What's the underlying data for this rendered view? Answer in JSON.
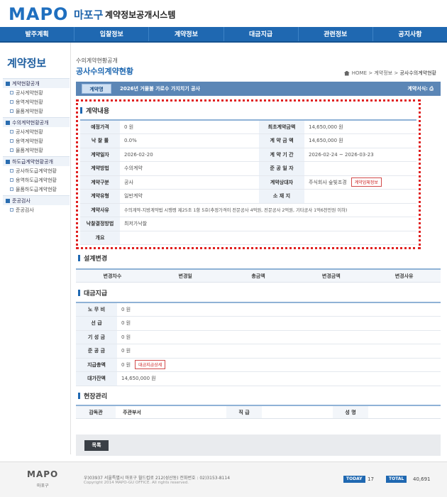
{
  "header": {
    "logo_text": "MAPO",
    "logo_gu": "마포구",
    "site_title": "계약정보공개시스템"
  },
  "gnb": [
    "발주계획",
    "입찰정보",
    "계약정보",
    "대금지급",
    "관련정보",
    "공지사항"
  ],
  "sidebar": {
    "title": "계약정보",
    "groups": [
      {
        "label": "계약현황공개",
        "items": [
          "공사계약현황",
          "용역계약현황",
          "물품계약현황"
        ]
      },
      {
        "label": "수의계약현황공개",
        "items": [
          "공사계약현황",
          "용역계약현황",
          "물품계약현황"
        ]
      },
      {
        "label": "하도급계약현황공개",
        "items": [
          "공사하도급계약현황",
          "용역하도급계약현황",
          "물품하도급계약현황"
        ]
      },
      {
        "label": "준공검사",
        "items": [
          "준공검사"
        ]
      }
    ]
  },
  "page": {
    "crumb_sub": "수의계약현황공개",
    "title": "공사수의계약현황",
    "location": {
      "home": "HOME",
      "sep1": ">",
      "l1": "계약정보",
      "sep2": ">",
      "current": "공사수의계약현황"
    }
  },
  "contract_bar": {
    "tag": "계약명",
    "name": "2026년 거물불 가로수 가지치기 공사",
    "type_label": "계약서식:"
  },
  "contract_details": {
    "heading": "계약내용",
    "rows": [
      {
        "l1": "예정가격",
        "v1": "0 원",
        "l2": "최초계약금액",
        "v2": "14,650,000 원"
      },
      {
        "l1": "낙 찰 률",
        "v1": "0.0%",
        "l2": "계 약 금 액",
        "v2": "14,650,000 원"
      },
      {
        "l1": "계약일자",
        "v1": "2026-02-20",
        "l2": "계 약 기 간",
        "v2": "2026-02-24 ~ 2026-03-23"
      },
      {
        "l1": "계약방법",
        "v1": "수의계약",
        "l2": "준 공 일 자",
        "v2": ""
      },
      {
        "l1": "계약구분",
        "v1": "공사",
        "l2": "계약상대자",
        "v2": "주식회사 숲빛조경"
      },
      {
        "l1": "계약유형",
        "v1": "일반계약",
        "l2": "소 재 지",
        "v2": ""
      }
    ],
    "vendor_button": "계약업체정보",
    "reason_label": "계약사유",
    "reason_value": "수의계약-지방계약법 시행령 제25조 1항 5호(추정가격이 전문공사 4억원, 전문공사 2억원, 기타공사 1억6천만원 이하)",
    "award_label": "낙찰결정방법",
    "award_value": "최저가낙찰",
    "summary_label": "개요",
    "summary_value": ""
  },
  "change_design": {
    "heading": "설계변경",
    "columns": [
      "변경차수",
      "변경일",
      "총금액",
      "변경금액",
      "변경사유"
    ]
  },
  "payment": {
    "heading": "대금지급",
    "rows": [
      {
        "label": "노 무 비",
        "value": "0 원"
      },
      {
        "label": "선 급",
        "value": "0 원"
      },
      {
        "label": "기 성 금",
        "value": "0 원"
      },
      {
        "label": "준 공 금",
        "value": "0 원"
      },
      {
        "label": "지급총액",
        "value": "0 원"
      },
      {
        "label": "대가잔액",
        "value": "14,650,000 원"
      }
    ],
    "detail_button": "대금지급상세"
  },
  "site_mgmt": {
    "heading": "현장관리",
    "dept_label": "감독관",
    "dept_value": "주관부서",
    "rank_label": "직 급",
    "rank_value": "",
    "name_label": "성 명",
    "name_value": ""
  },
  "list_button": "목록",
  "footer": {
    "logo": "MAPO",
    "logo_sub": "마포구",
    "address": "우)03937 서울특별시 마포구 월드컵로 212(성산동) 전화번호 : 02)3153-8114",
    "copyright": "Copyright 2014 MAPO-GU OFFICE. All rights reserved.",
    "today_label": "TODAY",
    "today_value": "17",
    "total_label": "TOTAL",
    "total_value": "40,691"
  },
  "colors": {
    "primary": "#1f68b1",
    "accent_red": "#e02020",
    "bar": "#5b86b6"
  }
}
